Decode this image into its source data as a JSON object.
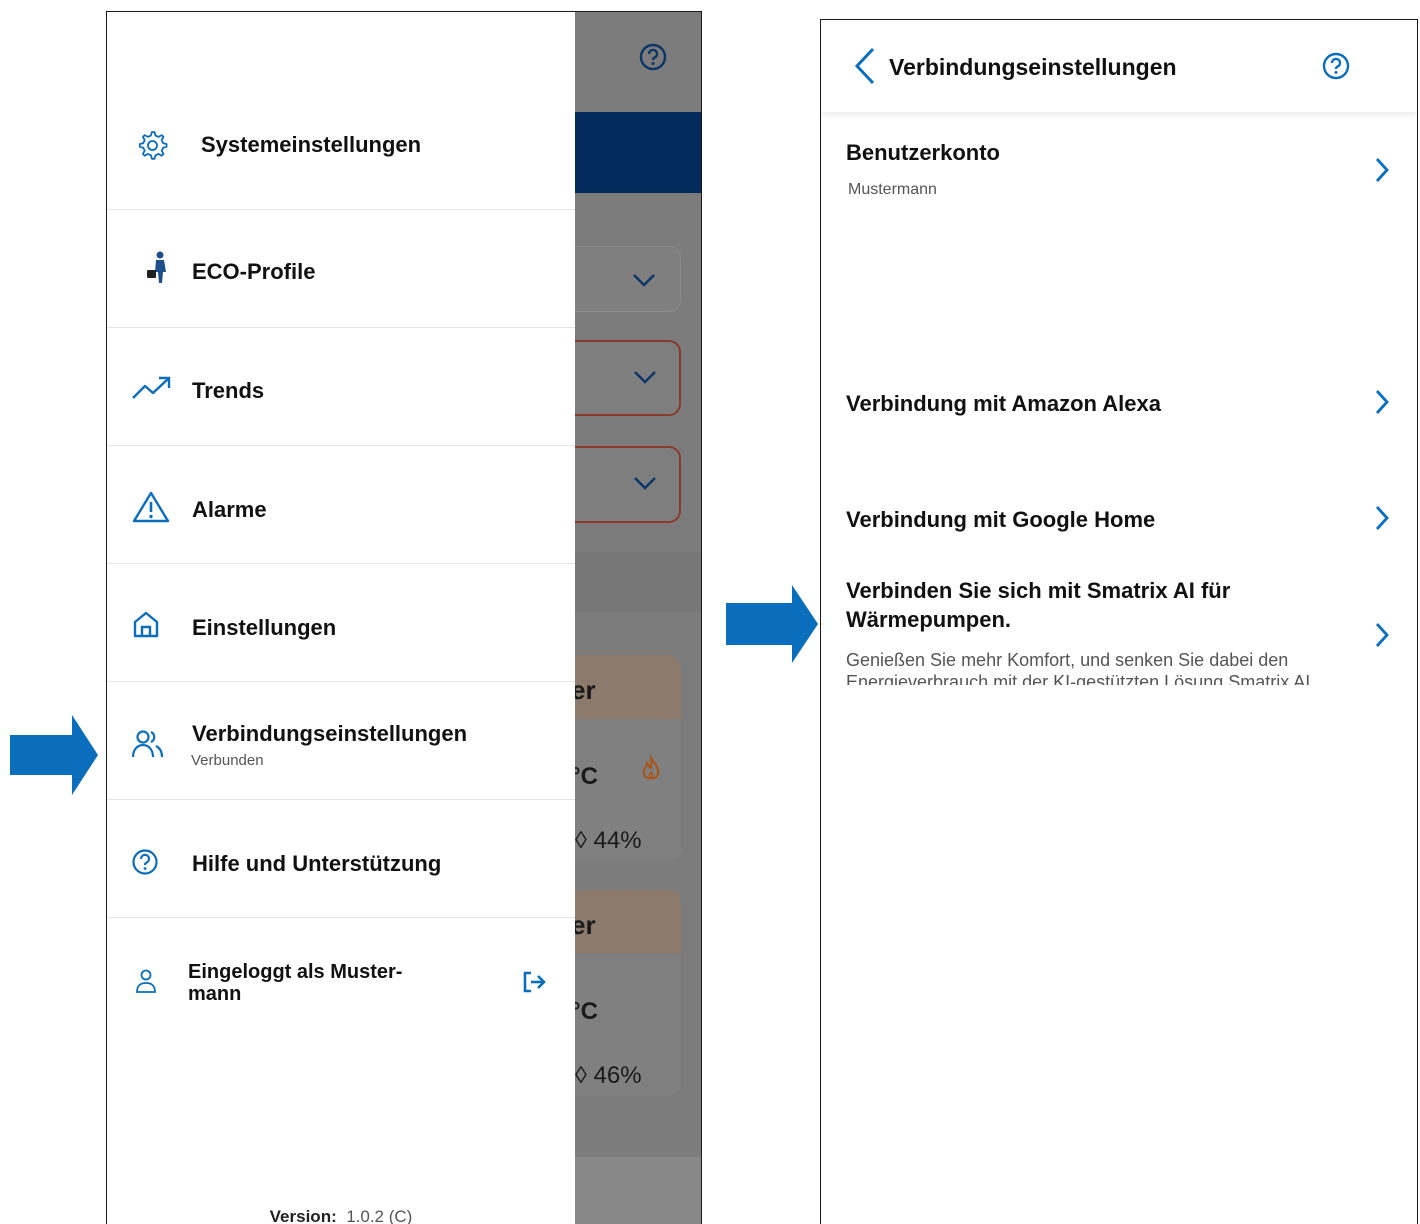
{
  "colors": {
    "accent": "#0a6ebd",
    "dark_blue": "#022a5a",
    "text": "#111111",
    "muted": "#555555",
    "heating": "#a8551a",
    "alert_border": "#8b3a2e"
  },
  "drawer": {
    "items": [
      {
        "label": "Systemeinstellungen",
        "icon": "gear-icon"
      },
      {
        "label": "ECO-Profile",
        "icon": "person-briefcase-icon"
      },
      {
        "label": "Trends",
        "icon": "trend-up-icon"
      },
      {
        "label": "Alarme",
        "icon": "warning-icon"
      },
      {
        "label": "Einstellungen",
        "icon": "home-icon"
      },
      {
        "label": "Verbindungseinstellungen",
        "sublabel": "Verbunden",
        "icon": "users-icon"
      },
      {
        "label": "Hilfe und Unterstützung",
        "icon": "help-icon"
      }
    ],
    "login": {
      "label": "Eingeloggt als Muster-\nmann",
      "icon": "user-icon",
      "action_icon": "logout-icon"
    },
    "version": {
      "label": "Version:",
      "value": "1.0.2 (C)"
    }
  },
  "background_app": {
    "room1": {
      "name": "er",
      "temp_unit": "°C",
      "humidity": "44%"
    },
    "room2": {
      "name": "er",
      "temp_unit": "°C",
      "humidity": "46%"
    }
  },
  "connection_screen": {
    "title": "Verbindungseinstellungen",
    "rows": [
      {
        "title": "Benutzerkonto",
        "subtitle": "Mustermann"
      },
      {
        "title": "Verbindung mit Amazon Alexa"
      },
      {
        "title": "Verbindung mit Google Home"
      },
      {
        "title": "Verbinden Sie sich mit Smatrix AI für Wärmepumpen.",
        "description": "Genießen Sie mehr Komfort, und senken Sie dabei den Energieverbrauch mit der KI-gestützten Lösung Smatrix AI."
      }
    ]
  }
}
